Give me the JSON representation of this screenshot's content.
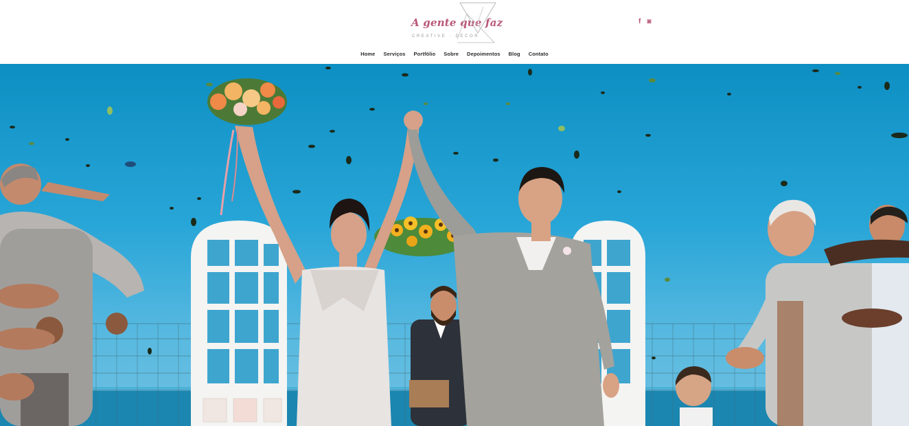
{
  "brand": {
    "script_name": "A gente que faz",
    "tagline": "CREATIVE · DECOR",
    "accent_color": "#b8577a"
  },
  "social": [
    {
      "icon": "facebook-icon",
      "glyph": "f"
    },
    {
      "icon": "instagram-icon",
      "glyph": "◙"
    }
  ],
  "nav": {
    "items": [
      "Home",
      "Serviços",
      "Portfólio",
      "Sobre",
      "Depoimentos",
      "Blog",
      "Contato"
    ]
  },
  "hero": {
    "image": "wedding-ceremony-photo",
    "sky_color": "#1c9fd3",
    "sea_color": "#1b86b0"
  }
}
